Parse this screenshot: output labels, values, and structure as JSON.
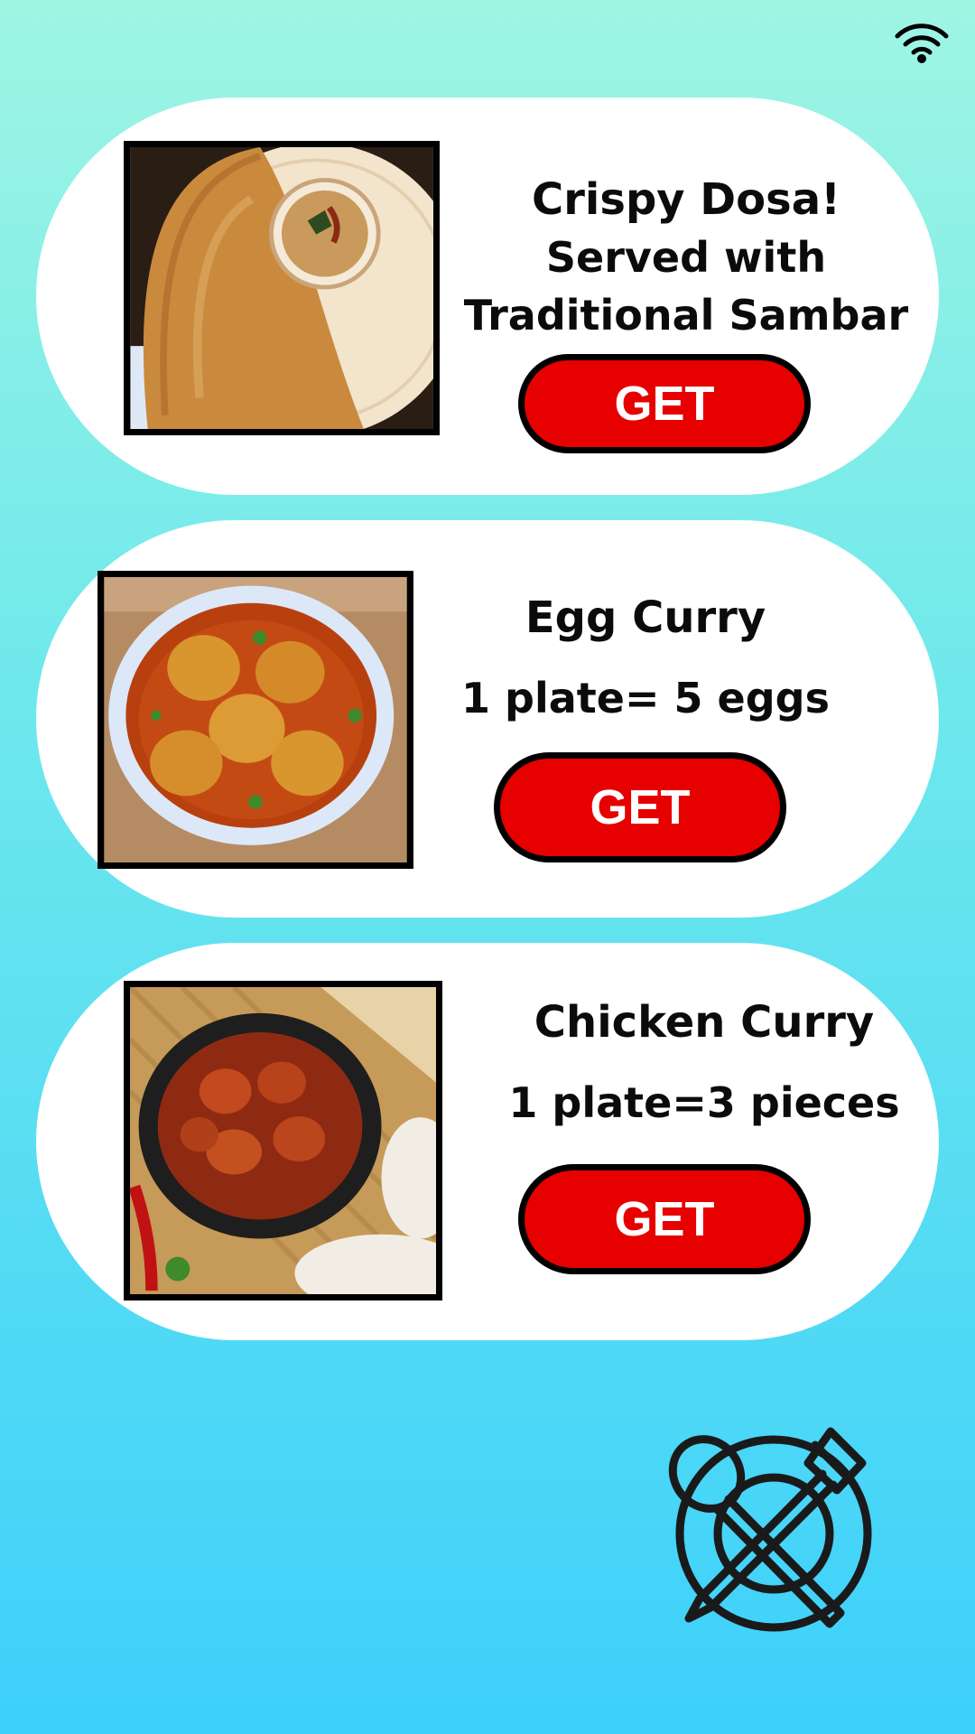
{
  "status_bar": {
    "wifi_icon": "wifi-icon"
  },
  "menu": [
    {
      "name": "Crispy Dosa!",
      "lines": [
        "Served with",
        "Traditional Sambar"
      ],
      "button": "GET",
      "image": "dosa-with-sambar-photo"
    },
    {
      "name": "Egg Curry",
      "lines": [
        "1 plate= 5 eggs"
      ],
      "button": "GET",
      "image": "egg-curry-photo"
    },
    {
      "name": "Chicken Curry",
      "lines": [
        "1 plate=3 pieces"
      ],
      "button": "GET",
      "image": "chicken-curry-photo"
    }
  ],
  "footer": {
    "icon": "plate-spoon-fork-icon"
  },
  "colors": {
    "background_top": "#9ff5e3",
    "background_bottom": "#3dd0fb",
    "card": "#ffffff",
    "button": "#e60000",
    "button_border": "#000000",
    "text": "#0b0b0b"
  }
}
